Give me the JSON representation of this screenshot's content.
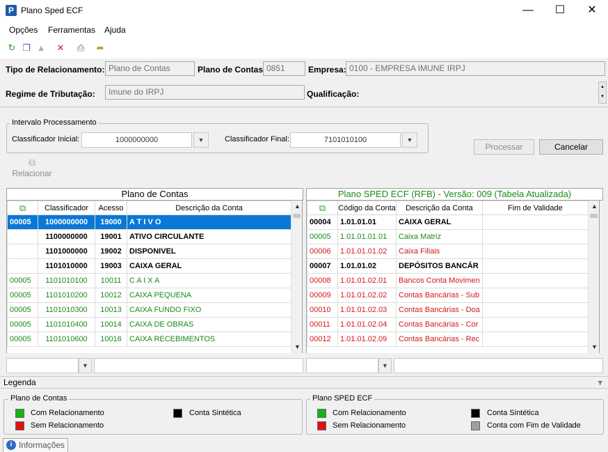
{
  "window": {
    "title": "Plano Sped ECF",
    "minimize": "—",
    "maximize": "☐",
    "close": "✕"
  },
  "menu": [
    "Opções",
    "Ferramentas",
    "Ajuda"
  ],
  "toolbar": {
    "refresh": "↻",
    "copy": "❐",
    "clear": "✕",
    "print": "⎙",
    "export": "➦"
  },
  "header": {
    "tipo_label": "Tipo de Relacionamento:",
    "tipo_value": "Plano de Contas",
    "plano_label": "Plano de Contas:",
    "plano_value": "0851",
    "empresa_label": "Empresa:",
    "empresa_value": "0100 - EMPRESA IMUNE IRPJ",
    "regime_label": "Regime de Tributação:",
    "regime_value": "Imune do IRPJ",
    "qualif_label": "Qualificação:"
  },
  "intervalo": {
    "title": "Intervalo Processamento",
    "inicial_label": "Classificador Inicial:",
    "inicial_value": "1000000000",
    "final_label": "Classificador Final:",
    "final_value": "7101010100"
  },
  "buttons": {
    "processar": "Processar",
    "cancelar": "Cancelar",
    "relacionar": "Relacionar"
  },
  "left_panel": {
    "title": "Plano de Contas",
    "columns": [
      "",
      "Classificador",
      "Acesso",
      "Descrição da Conta"
    ],
    "rows": [
      {
        "c0": "00005",
        "c1": "1000000000",
        "c2": "19000",
        "c3": "A T I V O",
        "type": "sel"
      },
      {
        "c0": "",
        "c1": "1100000000",
        "c2": "19001",
        "c3": "ATIVO CIRCULANTE",
        "type": "syn"
      },
      {
        "c0": "",
        "c1": "1101000000",
        "c2": "19002",
        "c3": "DISPONIVEL",
        "type": "syn"
      },
      {
        "c0": "",
        "c1": "1101010000",
        "c2": "19003",
        "c3": "CAIXA GERAL",
        "type": "syn"
      },
      {
        "c0": "00005",
        "c1": "1101010100",
        "c2": "10011",
        "c3": "C A I X A",
        "type": "green"
      },
      {
        "c0": "00005",
        "c1": "1101010200",
        "c2": "10012",
        "c3": "CAIXA PEQUENA",
        "type": "green"
      },
      {
        "c0": "00005",
        "c1": "1101010300",
        "c2": "10013",
        "c3": "CAIXA FUNDO FIXO",
        "type": "green"
      },
      {
        "c0": "00005",
        "c1": "1101010400",
        "c2": "10014",
        "c3": "CAIXA DE OBRAS",
        "type": "green"
      },
      {
        "c0": "00005",
        "c1": "1101010600",
        "c2": "10016",
        "c3": "CAIXA RECEBIMENTOS",
        "type": "green"
      }
    ]
  },
  "right_panel": {
    "title": "Plano SPED ECF (RFB) - Versão: 009 (Tabela Atualizada)",
    "columns": [
      "",
      "Código da Conta",
      "Descrição da Conta",
      "Fim de Validade"
    ],
    "rows": [
      {
        "c0": "00004",
        "c1": "1.01.01.01",
        "c2": "CAIXA GERAL",
        "c3": "",
        "type": "syn"
      },
      {
        "c0": "00005",
        "c1": "1.01.01.01.01",
        "c2": "Caixa Matriz",
        "c3": "",
        "type": "green"
      },
      {
        "c0": "00006",
        "c1": "1.01.01.01.02",
        "c2": "Caixa Filiais",
        "c3": "",
        "type": "red"
      },
      {
        "c0": "00007",
        "c1": "1.01.01.02",
        "c2": "DEPÓSITOS BANCÁR",
        "c3": "",
        "type": "syn"
      },
      {
        "c0": "00008",
        "c1": "1.01.01.02.01",
        "c2": "Bancos Conta Movimen",
        "c3": "",
        "type": "red"
      },
      {
        "c0": "00009",
        "c1": "1.01.01.02.02",
        "c2": "Contas Bancárias - Sub",
        "c3": "",
        "type": "red"
      },
      {
        "c0": "00010",
        "c1": "1.01.01.02.03",
        "c2": "Contas Bancárias - Doa",
        "c3": "",
        "type": "red"
      },
      {
        "c0": "00011",
        "c1": "1.01.01.02.04",
        "c2": "Contas Bancárias - Cor",
        "c3": "",
        "type": "red"
      },
      {
        "c0": "00012",
        "c1": "1.01.01.02.09",
        "c2": "Contas Bancárias - Rec",
        "c3": "",
        "type": "red"
      }
    ]
  },
  "legend": {
    "title": "Legenda",
    "pin": "ᚁ",
    "left": {
      "title": "Plano de Contas",
      "com": "Com Relacionamento",
      "sem": "Sem Relacionamento",
      "sint": "Conta Sintética"
    },
    "right": {
      "title": "Plano SPED ECF",
      "com": "Com Relacionamento",
      "sem": "Sem Relacionamento",
      "sint": "Conta Sintética",
      "fim": "Conta com Fim de Validade"
    }
  },
  "colors": {
    "green": "#1ab01a",
    "red": "#e01010",
    "black": "#000000",
    "gray": "#a0a0a0"
  },
  "status": {
    "informacoes": "Informações"
  }
}
